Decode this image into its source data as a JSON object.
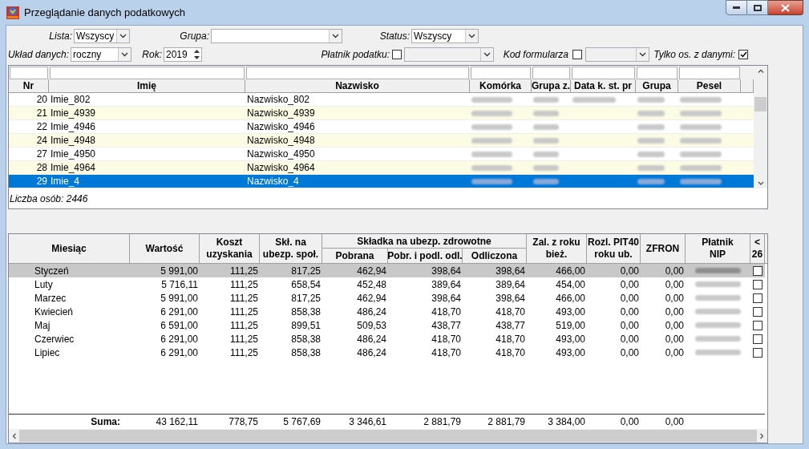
{
  "window": {
    "title": "Przeglądanie danych podatkowych"
  },
  "filters": {
    "lista": {
      "label": "Lista:",
      "value": "Wszyscy"
    },
    "grupa": {
      "label": "Grupa:"
    },
    "status": {
      "label": "Status:",
      "value": "Wszyscy"
    },
    "uklad": {
      "label": "Układ danych:",
      "value": "roczny"
    },
    "rok": {
      "label": "Rok:",
      "value": "2019"
    },
    "platnik": {
      "label": "Płatnik podatku:",
      "checked": false
    },
    "kod": {
      "label": "Kod formularza",
      "checked": false
    },
    "tylko": {
      "label": "Tylko os. z danymi:",
      "checked": true
    }
  },
  "people_table": {
    "columns": [
      "Nr",
      "Imię",
      "Nazwisko",
      "Komórka",
      "Grupa z.",
      "Data k. st. pr",
      "Grupa",
      "Pesel"
    ],
    "rows": [
      {
        "nr": "20",
        "imie": "Imie_802",
        "nazwisko": "Nazwisko_802",
        "date_blurred": true,
        "selected": false
      },
      {
        "nr": "21",
        "imie": "Imie_4939",
        "nazwisko": "Nazwisko_4939",
        "date_blurred": false,
        "selected": false
      },
      {
        "nr": "22",
        "imie": "Imie_4946",
        "nazwisko": "Nazwisko_4946",
        "date_blurred": false,
        "selected": false
      },
      {
        "nr": "24",
        "imie": "Imie_4948",
        "nazwisko": "Nazwisko_4948",
        "date_blurred": false,
        "selected": false
      },
      {
        "nr": "27",
        "imie": "Imie_4950",
        "nazwisko": "Nazwisko_4950",
        "date_blurred": false,
        "selected": false
      },
      {
        "nr": "28",
        "imie": "Imie_4964",
        "nazwisko": "Nazwisko_4964",
        "date_blurred": false,
        "selected": false
      },
      {
        "nr": "29",
        "imie": "Imie_4",
        "nazwisko": "Nazwisko_4",
        "date_blurred": false,
        "selected": true
      }
    ],
    "footer": "Liczba osób: 2446"
  },
  "months_table": {
    "group_header": "Składka na ubezp. zdrowotne",
    "columns": [
      "Miesiąc",
      "Wartość",
      "Koszt\nuzyskania",
      "Skł. na\nubezp. społ.",
      "Pobrana",
      "Pobr. i podl. odl.",
      "Odliczona",
      "Zal. z roku\nbież.",
      "Rozl. PIT40\nroku ub.",
      "ZFRON",
      "Płatnik\nNIP",
      "<\n26"
    ],
    "rows": [
      {
        "cells": [
          "Styczeń",
          "5 991,00",
          "111,25",
          "817,25",
          "462,94",
          "398,64",
          "398,64",
          "466,00",
          "0,00",
          "0,00"
        ],
        "checked": false,
        "selected": true
      },
      {
        "cells": [
          "Luty",
          "5 716,11",
          "111,25",
          "658,54",
          "452,48",
          "389,64",
          "389,64",
          "454,00",
          "0,00",
          "0,00"
        ],
        "checked": false,
        "selected": false
      },
      {
        "cells": [
          "Marzec",
          "5 991,00",
          "111,25",
          "817,25",
          "462,94",
          "398,64",
          "398,64",
          "466,00",
          "0,00",
          "0,00"
        ],
        "checked": false,
        "selected": false
      },
      {
        "cells": [
          "Kwiecień",
          "6 291,00",
          "111,25",
          "858,38",
          "486,24",
          "418,70",
          "418,70",
          "493,00",
          "0,00",
          "0,00"
        ],
        "checked": false,
        "selected": false
      },
      {
        "cells": [
          "Maj",
          "6 591,00",
          "111,25",
          "899,51",
          "509,53",
          "438,77",
          "438,77",
          "519,00",
          "0,00",
          "0,00"
        ],
        "checked": false,
        "selected": false
      },
      {
        "cells": [
          "Czerwiec",
          "6 291,00",
          "111,25",
          "858,38",
          "486,24",
          "418,70",
          "418,70",
          "493,00",
          "0,00",
          "0,00"
        ],
        "checked": false,
        "selected": false
      },
      {
        "cells": [
          "Lipiec",
          "6 291,00",
          "111,25",
          "858,38",
          "486,24",
          "418,70",
          "418,70",
          "493,00",
          "0,00",
          "0,00"
        ],
        "checked": false,
        "selected": false
      }
    ],
    "sum": {
      "label": "Suma:",
      "values": [
        "43 162,11",
        "778,75",
        "5 767,69",
        "3 346,61",
        "2 881,79",
        "2 881,79",
        "3 384,00",
        "0,00",
        "0,00"
      ]
    }
  }
}
